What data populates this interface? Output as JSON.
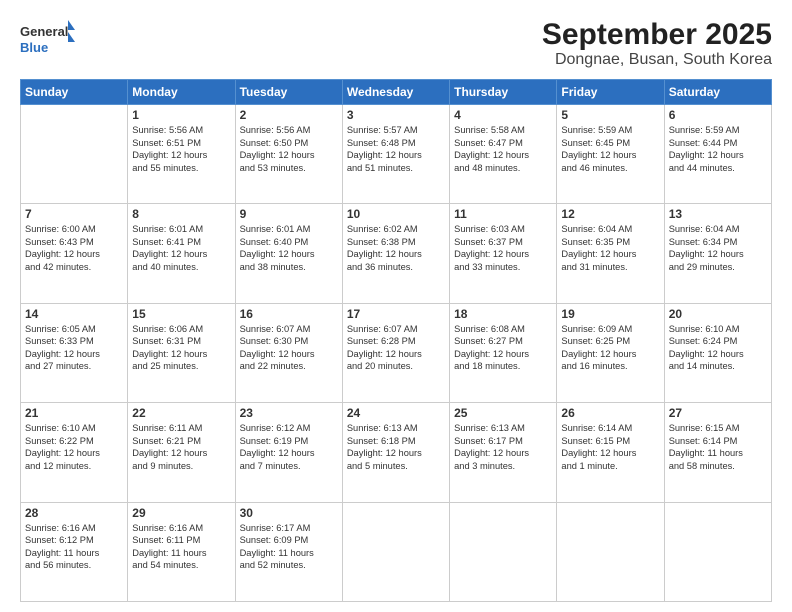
{
  "header": {
    "logo_line1": "General",
    "logo_line2": "Blue",
    "title": "September 2025",
    "subtitle": "Dongnae, Busan, South Korea"
  },
  "days_of_week": [
    "Sunday",
    "Monday",
    "Tuesday",
    "Wednesday",
    "Thursday",
    "Friday",
    "Saturday"
  ],
  "weeks": [
    [
      {
        "day": "",
        "content": ""
      },
      {
        "day": "1",
        "content": "Sunrise: 5:56 AM\nSunset: 6:51 PM\nDaylight: 12 hours\nand 55 minutes."
      },
      {
        "day": "2",
        "content": "Sunrise: 5:56 AM\nSunset: 6:50 PM\nDaylight: 12 hours\nand 53 minutes."
      },
      {
        "day": "3",
        "content": "Sunrise: 5:57 AM\nSunset: 6:48 PM\nDaylight: 12 hours\nand 51 minutes."
      },
      {
        "day": "4",
        "content": "Sunrise: 5:58 AM\nSunset: 6:47 PM\nDaylight: 12 hours\nand 48 minutes."
      },
      {
        "day": "5",
        "content": "Sunrise: 5:59 AM\nSunset: 6:45 PM\nDaylight: 12 hours\nand 46 minutes."
      },
      {
        "day": "6",
        "content": "Sunrise: 5:59 AM\nSunset: 6:44 PM\nDaylight: 12 hours\nand 44 minutes."
      }
    ],
    [
      {
        "day": "7",
        "content": "Sunrise: 6:00 AM\nSunset: 6:43 PM\nDaylight: 12 hours\nand 42 minutes."
      },
      {
        "day": "8",
        "content": "Sunrise: 6:01 AM\nSunset: 6:41 PM\nDaylight: 12 hours\nand 40 minutes."
      },
      {
        "day": "9",
        "content": "Sunrise: 6:01 AM\nSunset: 6:40 PM\nDaylight: 12 hours\nand 38 minutes."
      },
      {
        "day": "10",
        "content": "Sunrise: 6:02 AM\nSunset: 6:38 PM\nDaylight: 12 hours\nand 36 minutes."
      },
      {
        "day": "11",
        "content": "Sunrise: 6:03 AM\nSunset: 6:37 PM\nDaylight: 12 hours\nand 33 minutes."
      },
      {
        "day": "12",
        "content": "Sunrise: 6:04 AM\nSunset: 6:35 PM\nDaylight: 12 hours\nand 31 minutes."
      },
      {
        "day": "13",
        "content": "Sunrise: 6:04 AM\nSunset: 6:34 PM\nDaylight: 12 hours\nand 29 minutes."
      }
    ],
    [
      {
        "day": "14",
        "content": "Sunrise: 6:05 AM\nSunset: 6:33 PM\nDaylight: 12 hours\nand 27 minutes."
      },
      {
        "day": "15",
        "content": "Sunrise: 6:06 AM\nSunset: 6:31 PM\nDaylight: 12 hours\nand 25 minutes."
      },
      {
        "day": "16",
        "content": "Sunrise: 6:07 AM\nSunset: 6:30 PM\nDaylight: 12 hours\nand 22 minutes."
      },
      {
        "day": "17",
        "content": "Sunrise: 6:07 AM\nSunset: 6:28 PM\nDaylight: 12 hours\nand 20 minutes."
      },
      {
        "day": "18",
        "content": "Sunrise: 6:08 AM\nSunset: 6:27 PM\nDaylight: 12 hours\nand 18 minutes."
      },
      {
        "day": "19",
        "content": "Sunrise: 6:09 AM\nSunset: 6:25 PM\nDaylight: 12 hours\nand 16 minutes."
      },
      {
        "day": "20",
        "content": "Sunrise: 6:10 AM\nSunset: 6:24 PM\nDaylight: 12 hours\nand 14 minutes."
      }
    ],
    [
      {
        "day": "21",
        "content": "Sunrise: 6:10 AM\nSunset: 6:22 PM\nDaylight: 12 hours\nand 12 minutes."
      },
      {
        "day": "22",
        "content": "Sunrise: 6:11 AM\nSunset: 6:21 PM\nDaylight: 12 hours\nand 9 minutes."
      },
      {
        "day": "23",
        "content": "Sunrise: 6:12 AM\nSunset: 6:19 PM\nDaylight: 12 hours\nand 7 minutes."
      },
      {
        "day": "24",
        "content": "Sunrise: 6:13 AM\nSunset: 6:18 PM\nDaylight: 12 hours\nand 5 minutes."
      },
      {
        "day": "25",
        "content": "Sunrise: 6:13 AM\nSunset: 6:17 PM\nDaylight: 12 hours\nand 3 minutes."
      },
      {
        "day": "26",
        "content": "Sunrise: 6:14 AM\nSunset: 6:15 PM\nDaylight: 12 hours\nand 1 minute."
      },
      {
        "day": "27",
        "content": "Sunrise: 6:15 AM\nSunset: 6:14 PM\nDaylight: 11 hours\nand 58 minutes."
      }
    ],
    [
      {
        "day": "28",
        "content": "Sunrise: 6:16 AM\nSunset: 6:12 PM\nDaylight: 11 hours\nand 56 minutes."
      },
      {
        "day": "29",
        "content": "Sunrise: 6:16 AM\nSunset: 6:11 PM\nDaylight: 11 hours\nand 54 minutes."
      },
      {
        "day": "30",
        "content": "Sunrise: 6:17 AM\nSunset: 6:09 PM\nDaylight: 11 hours\nand 52 minutes."
      },
      {
        "day": "",
        "content": ""
      },
      {
        "day": "",
        "content": ""
      },
      {
        "day": "",
        "content": ""
      },
      {
        "day": "",
        "content": ""
      }
    ]
  ]
}
